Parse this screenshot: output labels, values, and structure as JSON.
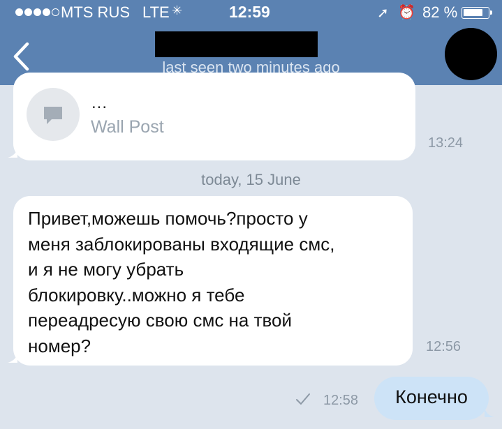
{
  "status_bar": {
    "carrier": "MTS RUS",
    "network": "LTE",
    "time": "12:59",
    "battery_percent": "82 %",
    "battery_level": 0.82,
    "signal_bars_filled": 4,
    "signal_bars_total": 5
  },
  "header": {
    "last_seen": "last seen two minutes ago",
    "background_color": "#5b82b2"
  },
  "messages": {
    "wall_post": {
      "title": "...",
      "label": "Wall Post",
      "time": "13:24"
    },
    "date_separator": "today, 15 June",
    "incoming": {
      "text": "Привет,можешь помочь?просто у\nменя заблокированы входящие смс,\nи я не могу убрать\nблокировку..можно я тебе\nпереадресую свою смс на твой\nномер?",
      "time": "12:56"
    },
    "outgoing": {
      "text": "Конечно",
      "time": "12:58",
      "bubble_color": "#cde3f7"
    }
  },
  "icons": {
    "back": "chevron-left-icon",
    "wall_post": "speech-bubble-icon",
    "status": "checkmark-icon"
  }
}
